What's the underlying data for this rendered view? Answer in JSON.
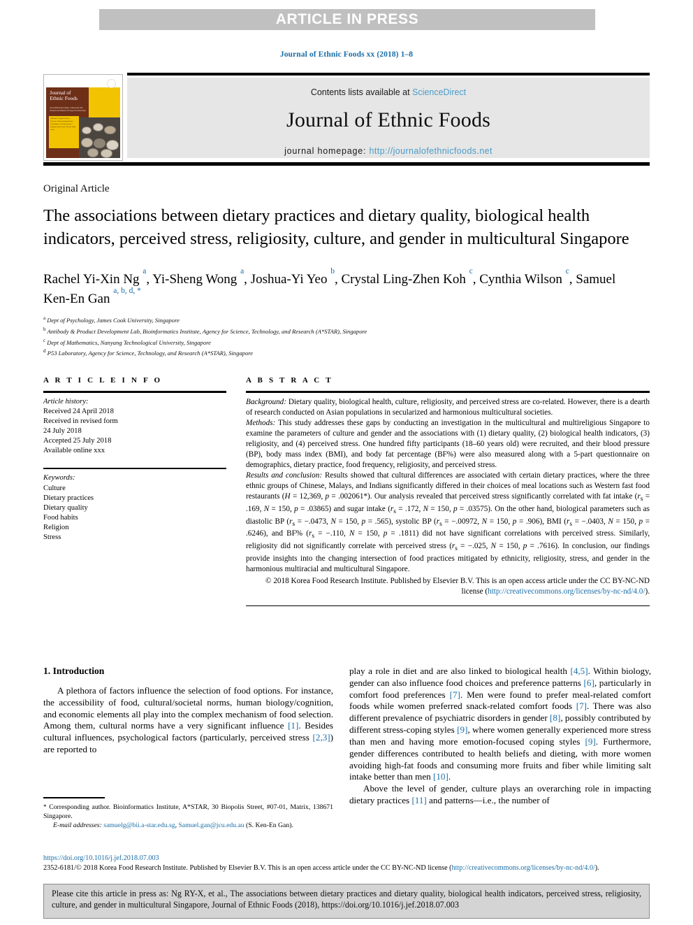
{
  "banner": {
    "text": "ARTICLE IN PRESS"
  },
  "running_head": "Journal of Ethnic Foods xx (2018) 1–8",
  "masthead": {
    "contents_prefix": "Contents lists available at ",
    "contents_link": "ScienceDirect",
    "journal_name": "Journal of Ethnic Foods",
    "homepage_label": "journal homepage: ",
    "homepage_url": "http://journalofethnicfoods.net",
    "cover": {
      "title_line1": "Journal of",
      "title_line2": "Ethnic Foods",
      "subtitle": "and traditional knowledge: Collaborated with Nutrition and Dietetics, Ecology and Gastronomy",
      "box_text": "Editorials / Original Articles / Reviews / Short communications / Food history / Food and culture / Regional ethnic foods / Korean ethnic foods"
    }
  },
  "article": {
    "type": "Original Article",
    "title": "The associations between dietary practices and dietary quality, biological health indicators, perceived stress, religiosity, culture, and gender in multicultural Singapore",
    "authors_html": "Rachel Yi-Xin Ng <sup>a</sup>, Yi-Sheng Wong <sup>a</sup>, Joshua-Yi Yeo <sup>b</sup>, Crystal Ling-Zhen Koh <sup>c</sup>, Cynthia Wilson <sup>c</sup>, Samuel Ken-En Gan <sup>a, b, d, *</sup>",
    "affiliations": [
      {
        "mark": "a",
        "text": "Dept of Psychology, James Cook University, Singapore"
      },
      {
        "mark": "b",
        "text": "Antibody & Product Development Lab, Bioinformatics Institute, Agency for Science, Technology, and Research (A*STAR), Singapore"
      },
      {
        "mark": "c",
        "text": "Dept of Mathematics, Nanyang Technological University, Singapore"
      },
      {
        "mark": "d",
        "text": "P53 Laboratory, Agency for Science, Technology, and Research (A*STAR), Singapore"
      }
    ]
  },
  "article_info": {
    "heading": "A R T I C L E   I N F O",
    "history_label": "Article history:",
    "history": [
      "Received 24 April 2018",
      "Received in revised form",
      "24 July 2018",
      "Accepted 25 July 2018",
      "Available online xxx"
    ],
    "keywords_label": "Keywords:",
    "keywords": [
      "Culture",
      "Dietary practices",
      "Dietary quality",
      "Food habits",
      "Religion",
      "Stress"
    ]
  },
  "abstract": {
    "heading": "A B S T R A C T",
    "background_label": "Background:",
    "background": " Dietary quality, biological health, culture, religiosity, and perceived stress are co-related. However, there is a dearth of research conducted on Asian populations in secularized and harmonious multicultural societies.",
    "methods_label": "Methods:",
    "methods": " This study addresses these gaps by conducting an investigation in the multicultural and multireligious Singapore to examine the parameters of culture and gender and the associations with (1) dietary quality, (2) biological health indicators, (3) religiosity, and (4) perceived stress. One hundred fifty participants (18–60 years old) were recruited, and their blood pressure (BP), body mass index (BMI), and body fat percentage (BF%) were also measured along with a 5-part questionnaire on demographics, dietary practice, food frequency, religiosity, and perceived stress.",
    "results_label": "Results and conclusion:",
    "results_html": " Results showed that cultural differences are associated with certain dietary practices, where the three ethnic groups of Chinese, Malays, and Indians significantly differed in their choices of meal locations such as Western fast food restaurants (<i>H</i> = 12,369, <i>p</i> = .002061*). Our analysis revealed that perceived stress significantly correlated with fat intake (<i>r</i><sub>s</sub> = .169, <i>N</i> = 150, <i>p</i> = .03865) and sugar intake (<i>r</i><sub>s</sub> = .172, <i>N</i> = 150, <i>p</i> = .03575). On the other hand, biological parameters such as diastolic BP (<i>r</i><sub>s</sub> = −.0473, <i>N</i> = 150, <i>p</i> = .565), systolic BP (<i>r</i><sub>s</sub> = −.00972, <i>N</i> = 150, <i>p</i> = .906), BMI (<i>r</i><sub>s</sub> = −.0403, <i>N</i> = 150, <i>p</i> = .6246), and BF% (<i>r</i><sub>s</sub> = −.110, <i>N</i> = 150, <i>p</i> = .1811) did not have significant correlations with perceived stress. Similarly, religiosity did not significantly correlate with perceived stress (<i>r</i><sub>s</sub> = −.025, <i>N</i> = 150, <i>p</i> = .7616). In conclusion, our findings provide insights into the changing intersection of food practices mitigated by ethnicity, religiosity, stress, and gender in the harmonious multiracial and multicultural Singapore.",
    "copyright_text": "© 2018 Korea Food Research Institute. Published by Elsevier B.V. This is an open access article under the CC BY-NC-ND license (",
    "copyright_link": "http://creativecommons.org/licenses/by-nc-nd/4.0/",
    "copyright_tail": ")."
  },
  "introduction": {
    "number_title": "1.  Introduction",
    "para1_html": "A plethora of factors influence the selection of food options. For instance, the accessibility of food, cultural/societal norms, human biology/cognition, and economic elements all play into the complex mechanism of food selection. Among them, cultural norms have a very significant influence <span class=\"ref\">[1]</span>. Besides cultural influences, psychological factors (particularly, perceived stress <span class=\"ref\">[2,3]</span>) are reported to",
    "para1_cont_html": "play a role in diet and are also linked to biological health <span class=\"ref\">[4,5]</span>. Within biology, gender can also influence food choices and preference patterns <span class=\"ref\">[6]</span>, particularly in comfort food preferences <span class=\"ref\">[7]</span>. Men were found to prefer meal-related comfort foods while women preferred snack-related comfort foods <span class=\"ref\">[7]</span>. There was also different prevalence of psychiatric disorders in gender <span class=\"ref\">[8]</span>, possibly contributed by different stress-coping styles <span class=\"ref\">[9]</span>, where women generally experienced more stress than men and having more emotion-focused coping styles <span class=\"ref\">[9]</span>. Furthermore, gender differences contributed to health beliefs and dieting, with more women avoiding high-fat foods and consuming more fruits and fiber while limiting salt intake better than men <span class=\"ref\">[10]</span>.",
    "para2_html": "Above the level of gender, culture plays an overarching role in impacting dietary practices <span class=\"ref\">[11]</span> and patterns—i.e., the number of"
  },
  "footnote": {
    "corresponding_html": "<span class=\"star\">*</span>  Corresponding author. Bioinformatics Institute, A*STAR, 30 Biopolis Street, #07-01, Matrix, 138671 Singapore.",
    "email_label": "E-mail addresses:",
    "email1": "samuelg@bii.a-star.edu.sg",
    "email2": "Samuel.gan@jcu.edu.au",
    "email_tail": "(S. Ken-En Gan)."
  },
  "bottom": {
    "doi": "https://doi.org/10.1016/j.jef.2018.07.003",
    "issn_text": "2352-6181/© 2018 Korea Food Research Institute. Published by Elsevier B.V. This is an open access article under the CC BY-NC-ND license (",
    "issn_link": "http://creativecommons.org/licenses/by-nc-nd/4.0/",
    "issn_tail": ")."
  },
  "cite_box": {
    "text": "Please cite this article in press as: Ng RY-X, et al., The associations between dietary practices and dietary quality, biological health indicators, perceived stress, religiosity, culture, and gender in multicultural Singapore, Journal of Ethnic Foods (2018), https://doi.org/10.1016/j.jef.2018.07.003"
  },
  "colors": {
    "link": "#1a6ea8",
    "banner_bg": "#c0c0c0",
    "masthead_bg": "#e6e6e6",
    "cite_bg": "#d4d4d4"
  }
}
